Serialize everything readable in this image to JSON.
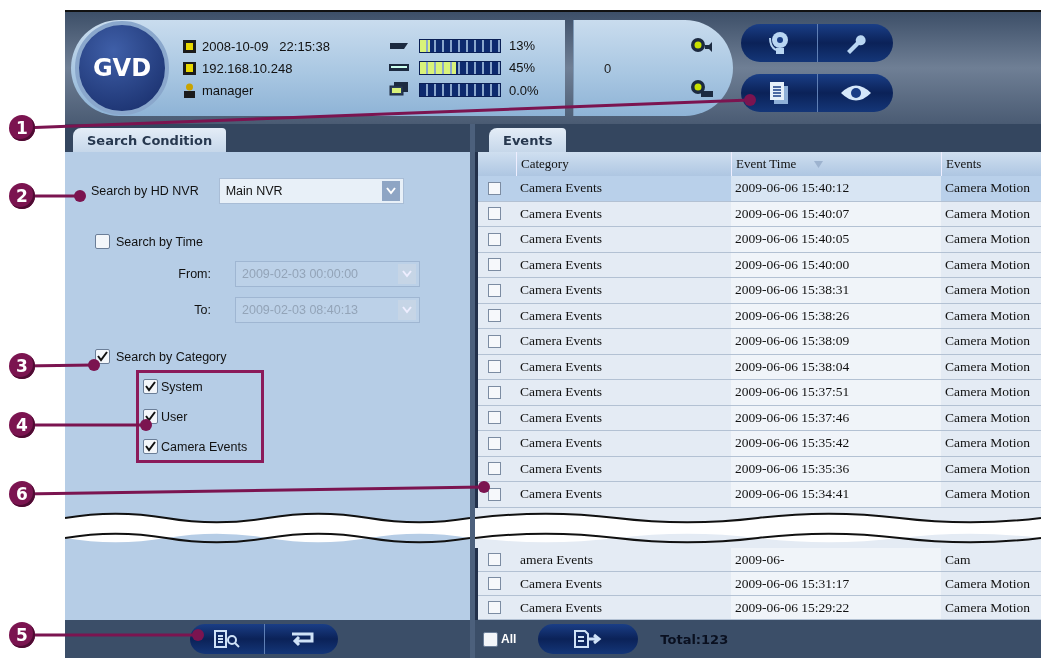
{
  "header": {
    "logo": "GVD",
    "date_time": "2008-10-09   22:15:38",
    "ip_address": "192.168.10.248",
    "user": "manager",
    "meters": [
      {
        "kind": "cpu",
        "level": 0.13,
        "reading": "13%"
      },
      {
        "kind": "memory",
        "level": 0.45,
        "reading": "45%"
      },
      {
        "kind": "network",
        "level": 0,
        "reading": "0.0%"
      }
    ],
    "event_count": "0"
  },
  "search_panel": {
    "tab": {
      "label": "Search Condition",
      "selected": true
    },
    "nvr_label": "Search by HD NVR",
    "nvr_value": "Main NVR",
    "time_filter": {
      "label": "Search by Time",
      "checked": false
    },
    "from_label": "From:",
    "from_value": "2009-02-03 00:00:00",
    "to_label": "To:",
    "to_value": "2009-02-03 08:40:13",
    "category_filter": {
      "label": "Search by Category",
      "checked": true
    },
    "categories": [
      {
        "label": "System",
        "checked": true
      },
      {
        "label": "User",
        "checked": true
      },
      {
        "label": "Camera Events",
        "checked": true
      }
    ]
  },
  "events_panel": {
    "tab": {
      "label": "Events",
      "selected": true
    },
    "columns": [
      "Category",
      "Event Time",
      "Events"
    ],
    "rows_above": [
      {
        "category": "Camera Events",
        "time": "2009-06-06 15:40:12",
        "event": "Camera Motion",
        "checked": false,
        "selected": true
      },
      {
        "category": "Camera Events",
        "time": "2009-06-06 15:40:07",
        "event": "Camera Motion",
        "checked": false,
        "selected": false
      },
      {
        "category": "Camera Events",
        "time": "2009-06-06 15:40:05",
        "event": "Camera Motion",
        "checked": false,
        "selected": false
      },
      {
        "category": "Camera Events",
        "time": "2009-06-06 15:40:00",
        "event": "Camera Motion",
        "checked": false,
        "selected": false
      },
      {
        "category": "Camera Events",
        "time": "2009-06-06 15:38:31",
        "event": "Camera Motion",
        "checked": false,
        "selected": false
      },
      {
        "category": "Camera Events",
        "time": "2009-06-06 15:38:26",
        "event": "Camera Motion",
        "checked": false,
        "selected": false
      },
      {
        "category": "Camera Events",
        "time": "2009-06-06 15:38:09",
        "event": "Camera Motion",
        "checked": false,
        "selected": false
      },
      {
        "category": "Camera Events",
        "time": "2009-06-06 15:38:04",
        "event": "Camera Motion",
        "checked": false,
        "selected": false
      },
      {
        "category": "Camera Events",
        "time": "2009-06-06 15:37:51",
        "event": "Camera Motion",
        "checked": false,
        "selected": false
      },
      {
        "category": "Camera Events",
        "time": "2009-06-06 15:37:46",
        "event": "Camera Motion",
        "checked": false,
        "selected": false
      },
      {
        "category": "Camera Events",
        "time": "2009-06-06 15:35:42",
        "event": "Camera Motion",
        "checked": false,
        "selected": false
      },
      {
        "category": "Camera Events",
        "time": "2009-06-06 15:35:36",
        "event": "Camera Motion",
        "checked": false,
        "selected": false
      },
      {
        "category": "Camera Events",
        "time": "2009-06-06 15:34:41",
        "event": "Camera Motion",
        "checked": false,
        "selected": false
      }
    ],
    "rows_below": [
      {
        "category": "amera Events",
        "time": "2009-06-",
        "event": "Cam",
        "checked": false,
        "selected": false
      },
      {
        "category": "Camera Events",
        "time": "2009-06-06 15:31:17",
        "event": "Camera Motion",
        "checked": false,
        "selected": false
      },
      {
        "category": "Camera Events",
        "time": "2009-06-06 15:29:22",
        "event": "Camera Motion",
        "checked": false,
        "selected": false
      }
    ],
    "select_all": {
      "label": "All",
      "checked": false
    },
    "total": "Total:123"
  },
  "callouts": [
    "1",
    "2",
    "3",
    "4",
    "6",
    "5"
  ]
}
